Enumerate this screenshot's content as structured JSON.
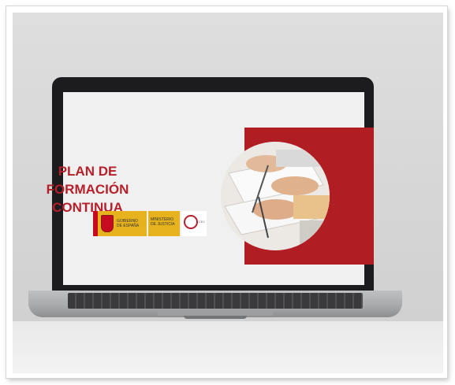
{
  "slide": {
    "title_line1": "PLAN DE FORMACIÓN",
    "title_line2": "CONTINUA"
  },
  "logos": {
    "government_logo": "GOBIERNO DE ESPAÑA",
    "ministry_logo": "MINISTERIO DE JUSTICIA",
    "cej_logo": "CEJ"
  },
  "colors": {
    "title_red": "#b5202a",
    "panel_red": "#b01e24",
    "logo_yellow": "#e6b31e"
  },
  "icons": {
    "government_emblem": "spain-coat-of-arms-icon",
    "cej_emblem": "cej-ring-icon"
  }
}
